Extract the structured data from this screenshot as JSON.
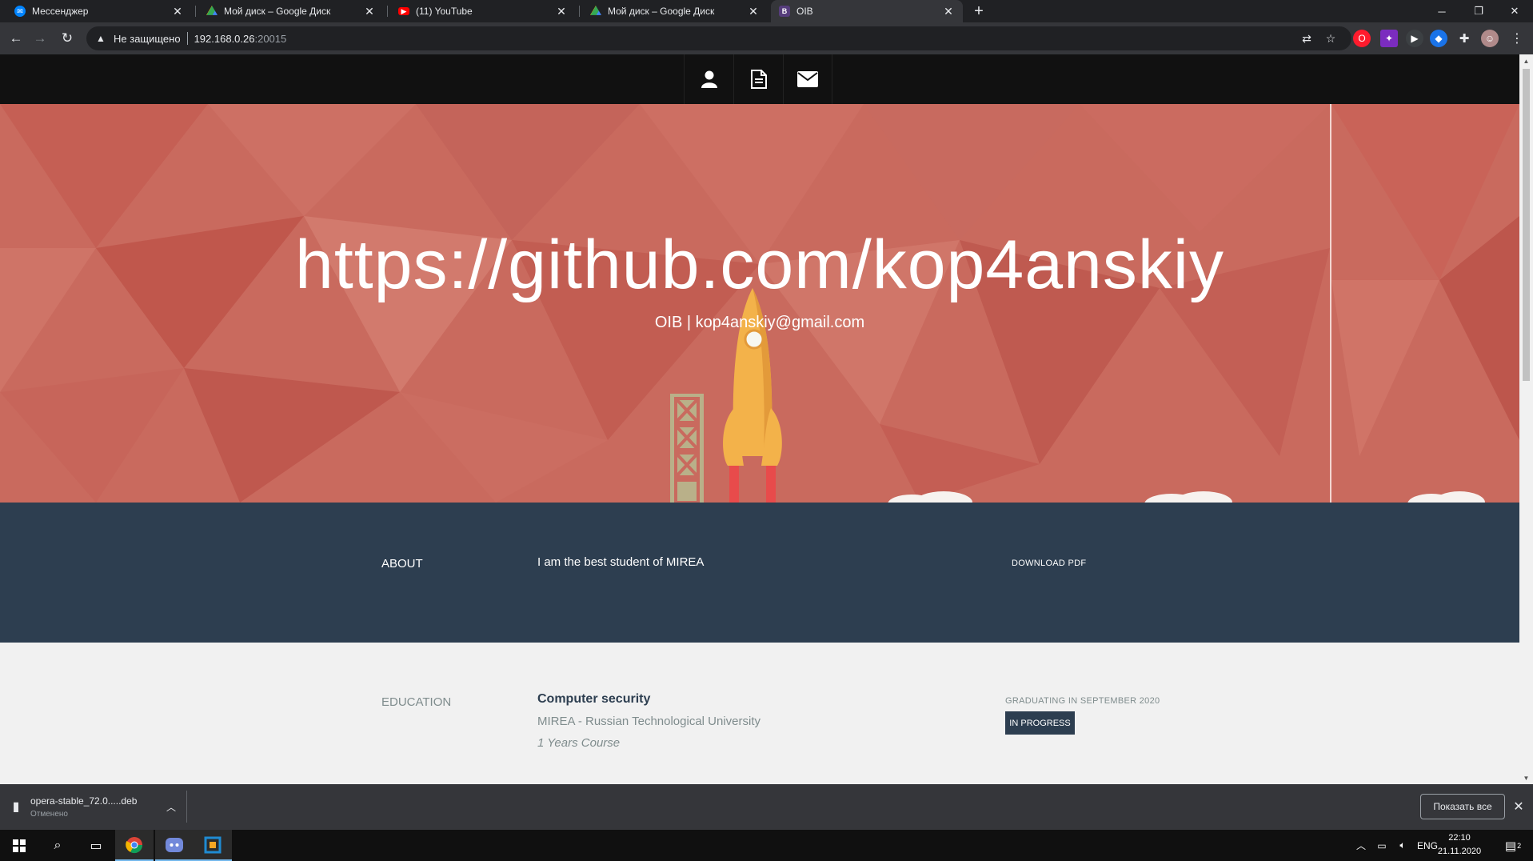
{
  "browser": {
    "tabs": [
      {
        "title": "Мессенджер",
        "icon": "messenger-icon",
        "color": "#0084ff"
      },
      {
        "title": "Мой диск – Google Диск",
        "icon": "google-drive-icon",
        "color": "#34a853"
      },
      {
        "title": "(11) YouTube",
        "icon": "youtube-icon",
        "color": "#ff0000"
      },
      {
        "title": "Мой диск – Google Диск",
        "icon": "google-drive-icon",
        "color": "#34a853"
      },
      {
        "title": "OIB",
        "icon": "bootstrap-icon",
        "color": "#563d7c",
        "favtext": "B"
      }
    ],
    "address": {
      "security": "Не защищено",
      "host": "192.168.0.26",
      "port": ":20015"
    }
  },
  "site": {
    "hero": {
      "title": "https://github.com/kop4anskiy",
      "subtitle": "OIB | kop4anskiy@gmail.com"
    },
    "about": {
      "label": "ABOUT",
      "text": "I am the best student of MIREA",
      "download": "DOWNLOAD PDF"
    },
    "education": {
      "label": "EDUCATION",
      "degree": "Computer security",
      "university": "MIREA - Russian Technological University",
      "duration": "1 Years Course",
      "graduating": "GRADUATING IN SEPTEMBER 2020",
      "badge": "IN PROGRESS"
    }
  },
  "downloads": {
    "file": "opera-stable_72.0.....deb",
    "status": "Отменено",
    "show_all": "Показать все"
  },
  "taskbar": {
    "lang": "ENG",
    "time": "22:10",
    "date": "21.11.2020",
    "notifications": "2"
  },
  "colors": {
    "hero": "#c96a5e",
    "about": "#2d3e50",
    "education": "#f1f1f1"
  }
}
